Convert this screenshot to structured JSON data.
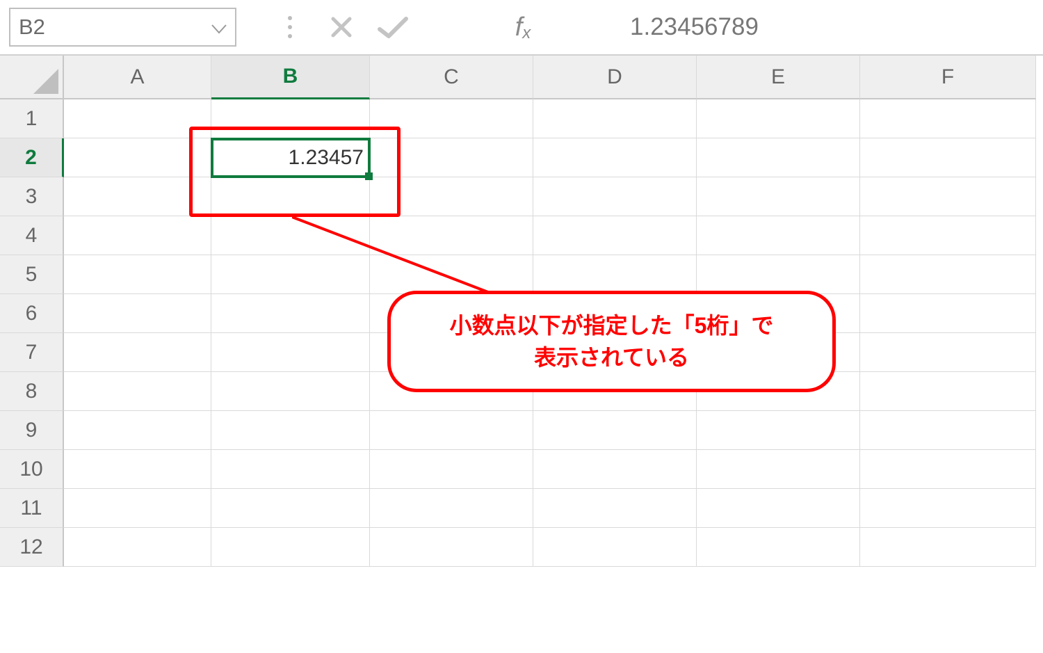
{
  "namebox": {
    "value": "B2"
  },
  "formula_bar": {
    "value": "1.23456789"
  },
  "columns": [
    "A",
    "B",
    "C",
    "D",
    "E",
    "F"
  ],
  "rows": [
    "1",
    "2",
    "3",
    "4",
    "5",
    "6",
    "7",
    "8",
    "9",
    "10",
    "11",
    "12"
  ],
  "selected": {
    "col": "B",
    "row": "2"
  },
  "cells": {
    "B2": "1.23457"
  },
  "annotation": {
    "callout_line1": "小数点以下が指定した「5桁」で",
    "callout_line2": "表示されている"
  }
}
